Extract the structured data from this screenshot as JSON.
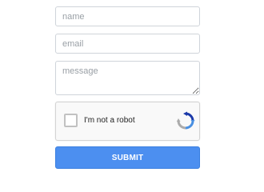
{
  "form": {
    "name": {
      "placeholder": "name",
      "value": ""
    },
    "email": {
      "placeholder": "email",
      "value": ""
    },
    "message": {
      "placeholder": "message",
      "value": ""
    },
    "captcha": {
      "label": "I'm not a robot",
      "checked": false,
      "icon": "recaptcha-icon"
    },
    "submit_label": "SUBMIT"
  },
  "colors": {
    "submit_background": "#4c8ff0",
    "submit_text": "#ffffff",
    "field_border": "#cfd4da",
    "placeholder_text": "#9aa0a6",
    "captcha_background": "#f9f9f9"
  }
}
